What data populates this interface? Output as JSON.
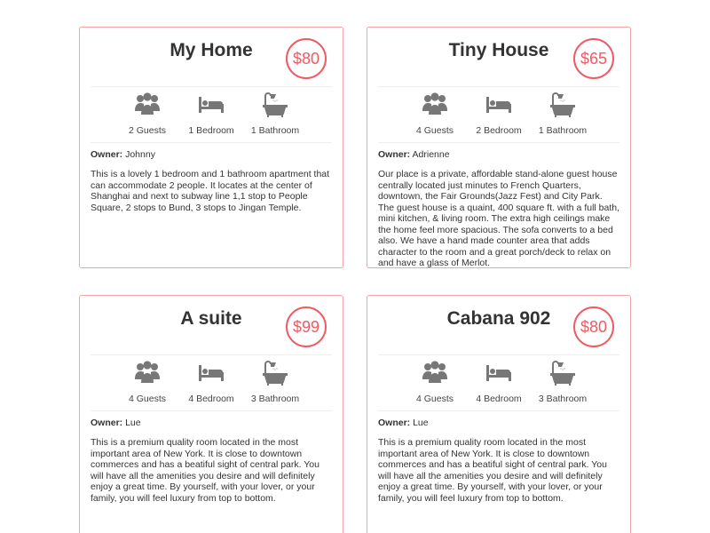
{
  "listings": [
    {
      "title": "My Home",
      "price": "$80",
      "amenities": {
        "guests": "2 Guests",
        "bedrooms": "1 Bedroom",
        "bathrooms": "1 Bathroom"
      },
      "owner_label": "Owner:",
      "owner": "Johnny",
      "description": "This is a lovely 1 bedroom and 1 bathroom apartment that can accommodate 2 people. It locates at the center of Shanghai and next to subway line 1,1 stop to People Square, 2 stops to Bund, 3 stops to Jingan Temple."
    },
    {
      "title": "Tiny House",
      "price": "$65",
      "amenities": {
        "guests": "4 Guests",
        "bedrooms": "2 Bedroom",
        "bathrooms": "1 Bathroom"
      },
      "owner_label": "Owner:",
      "owner": "Adrienne",
      "description": "Our place is a private, affordable stand-alone guest house centrally located just minutes to French Quarters, downtown, the Fair Grounds(Jazz Fest) and City Park. The guest house is a quaint, 400 square ft. with a full bath, mini kitchen, & living room. The extra high ceilings make the home feel more spacious. The sofa converts to a bed also. We have a hand made counter area that adds character to the room and a great porch/deck to relax on and have a glass of Merlot."
    },
    {
      "title": "A suite",
      "price": "$99",
      "amenities": {
        "guests": "4 Guests",
        "bedrooms": "4 Bedroom",
        "bathrooms": "3 Bathroom"
      },
      "owner_label": "Owner:",
      "owner": "Lue",
      "description": "This is a premium quality room located in the most important area of New York. It is close to downtown commerces and has a beatiful sight of central park. You will have all the amenities you desire and will definitely enjoy a great time. By yourself, with your lover, or your family, you will feel luxury from top to bottom."
    },
    {
      "title": "Cabana 902",
      "price": "$80",
      "amenities": {
        "guests": "4 Guests",
        "bedrooms": "4 Bedroom",
        "bathrooms": "3 Bathroom"
      },
      "owner_label": "Owner:",
      "owner": "Lue",
      "description": "This is a premium quality room located in the most important area of New York. It is close to downtown commerces and has a beatiful sight of central park. You will have all the amenities you desire and will definitely enjoy a great time. By yourself, with your lover, or your family, you will feel luxury from top to bottom."
    }
  ],
  "icons": {
    "guests": "users-icon",
    "bedrooms": "bed-icon",
    "bathrooms": "bathtub-icon"
  },
  "colors": {
    "accent": "#ef5a63",
    "card_border": "#f4a3a8",
    "icon_gray": "#777777"
  }
}
